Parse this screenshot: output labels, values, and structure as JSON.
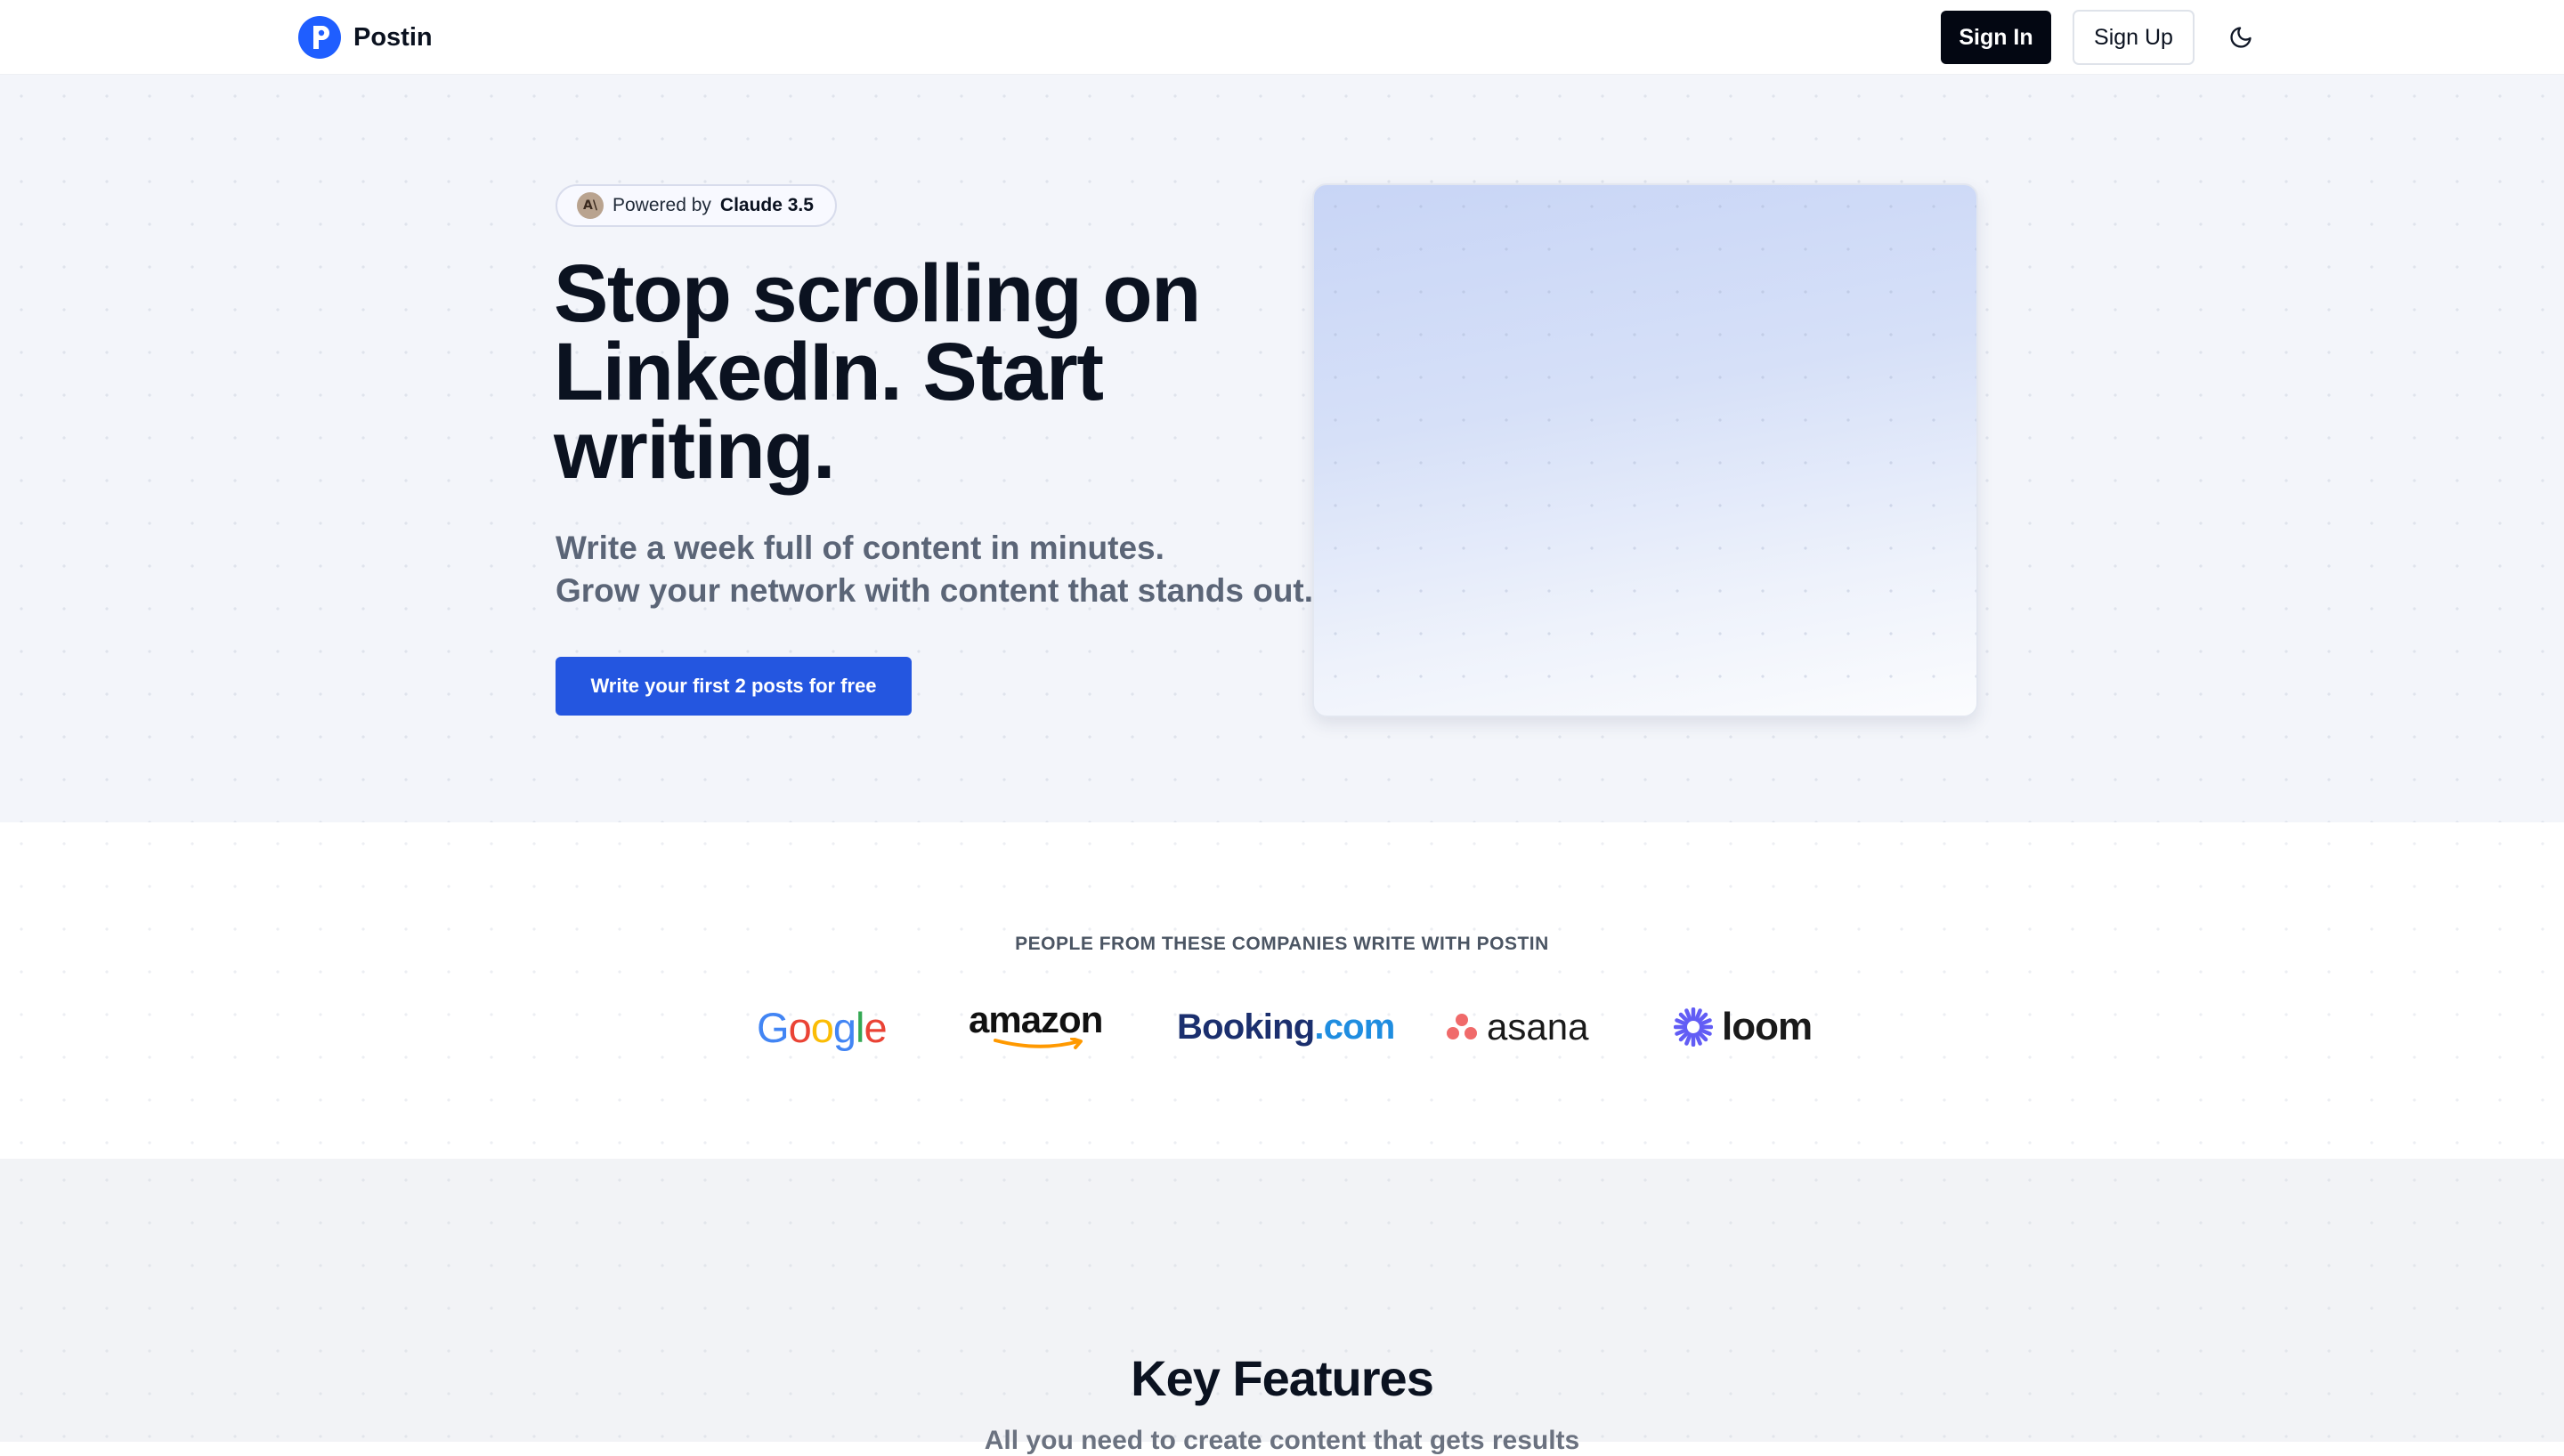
{
  "nav": {
    "brand": "Postin",
    "sign_in": "Sign In",
    "sign_up": "Sign Up",
    "theme_icon": "moon-icon"
  },
  "hero": {
    "badge_prefix": "Powered by",
    "badge_model": "Claude 3.5",
    "badge_icon_text": "A\\",
    "headline": "Stop scrolling on LinkedIn. Start writing.",
    "subline_1": "Write a week full of content in minutes.",
    "subline_2": "Grow your network with content that stands out.",
    "cta": "Write your first 2 posts for free"
  },
  "companies": {
    "heading": "PEOPLE FROM THESE COMPANIES WRITE WITH POSTIN",
    "logos": {
      "google": [
        "G",
        "o",
        "o",
        "g",
        "l",
        "e"
      ],
      "amazon": "amazon",
      "booking_main": "Booking",
      "booking_suffix": ".com",
      "asana": "asana",
      "loom": "loom"
    }
  },
  "features": {
    "title": "Key Features",
    "subtitle": "All you need to create content that gets results"
  },
  "colors": {
    "brand_blue": "#1f5eff",
    "cta_blue": "#2456e0",
    "sign_in_bg": "#030712"
  }
}
